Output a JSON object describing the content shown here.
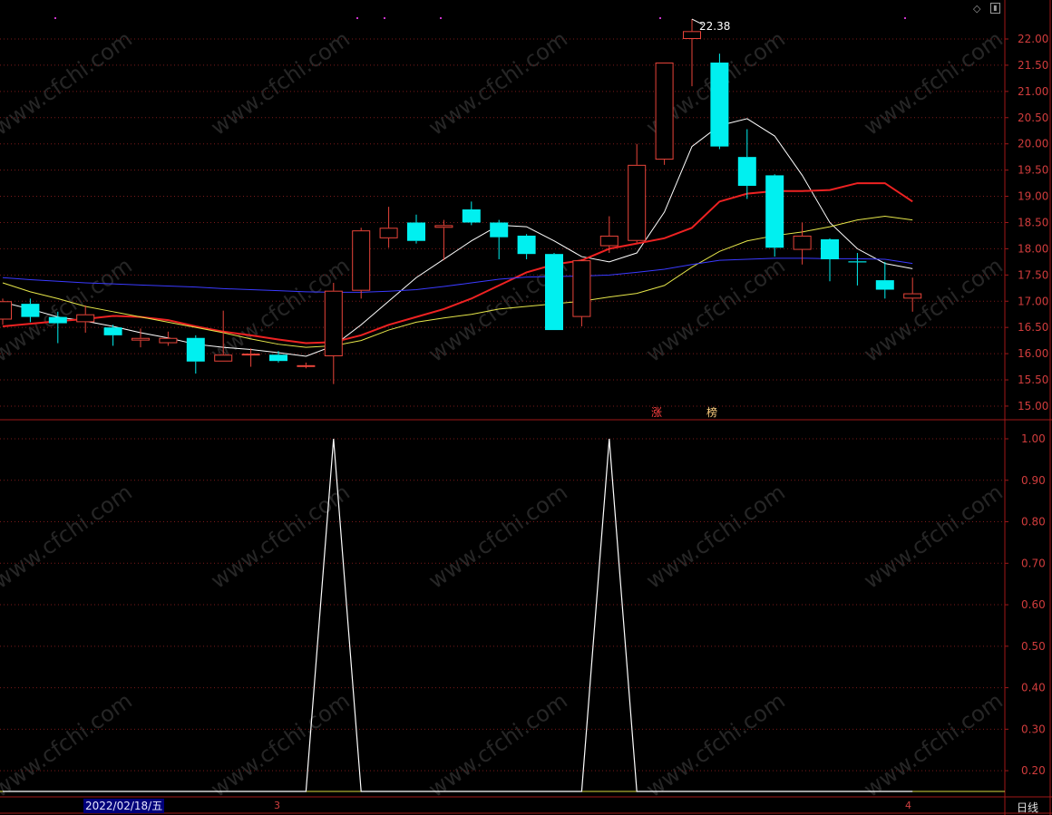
{
  "chart_data": [
    {
      "type": "candlestick",
      "title": "",
      "ylim": [
        14.8,
        22.45
      ],
      "y_ticks": [
        "22.00",
        "21.50",
        "21.00",
        "20.50",
        "20.00",
        "19.50",
        "19.00",
        "18.50",
        "18.00",
        "17.50",
        "17.00",
        "16.50",
        "16.00",
        "15.50",
        "15.00"
      ],
      "candles": [
        {
          "open": 16.65,
          "close": 17.0,
          "high": 17.05,
          "low": 16.55
        },
        {
          "open": 16.95,
          "close": 16.7,
          "high": 17.05,
          "low": 16.6
        },
        {
          "open": 16.7,
          "close": 16.58,
          "high": 16.8,
          "low": 16.2
        },
        {
          "open": 16.6,
          "close": 16.75,
          "high": 16.92,
          "low": 16.4
        },
        {
          "open": 16.5,
          "close": 16.35,
          "high": 16.55,
          "low": 16.15
        },
        {
          "open": 16.25,
          "close": 16.3,
          "high": 16.48,
          "low": 16.12
        },
        {
          "open": 16.2,
          "close": 16.3,
          "high": 16.42,
          "low": 16.15
        },
        {
          "open": 16.3,
          "close": 15.85,
          "high": 16.35,
          "low": 15.62
        },
        {
          "open": 15.85,
          "close": 15.98,
          "high": 16.82,
          "low": 15.85
        },
        {
          "open": 15.98,
          "close": 16.0,
          "high": 16.1,
          "low": 15.75
        },
        {
          "open": 15.98,
          "close": 15.86,
          "high": 16.05,
          "low": 15.83
        },
        {
          "open": 15.76,
          "close": 15.78,
          "high": 15.83,
          "low": 15.72
        },
        {
          "open": 15.95,
          "close": 17.2,
          "high": 17.35,
          "low": 15.42
        },
        {
          "open": 17.2,
          "close": 18.35,
          "high": 18.4,
          "low": 17.05
        },
        {
          "open": 18.2,
          "close": 18.4,
          "high": 18.8,
          "low": 18.02
        },
        {
          "open": 18.5,
          "close": 18.15,
          "high": 18.65,
          "low": 18.1
        },
        {
          "open": 18.4,
          "close": 18.45,
          "high": 18.55,
          "low": 17.78
        },
        {
          "open": 18.75,
          "close": 18.5,
          "high": 18.9,
          "low": 18.45
        },
        {
          "open": 18.5,
          "close": 18.22,
          "high": 18.55,
          "low": 17.8
        },
        {
          "open": 18.25,
          "close": 17.9,
          "high": 18.28,
          "low": 17.8
        },
        {
          "open": 17.9,
          "close": 16.45,
          "high": 17.92,
          "low": 16.45
        },
        {
          "open": 16.7,
          "close": 17.78,
          "high": 17.8,
          "low": 16.52
        },
        {
          "open": 18.05,
          "close": 18.25,
          "high": 18.62,
          "low": 17.92
        },
        {
          "open": 18.15,
          "close": 19.6,
          "high": 20.0,
          "low": 18.12
        },
        {
          "open": 19.7,
          "close": 21.55,
          "high": 21.55,
          "low": 19.6
        },
        {
          "open": 22.0,
          "close": 22.15,
          "high": 22.38,
          "low": 21.1
        },
        {
          "open": 21.55,
          "close": 19.95,
          "high": 21.72,
          "low": 19.9
        },
        {
          "open": 19.75,
          "close": 19.2,
          "high": 20.28,
          "low": 18.95
        },
        {
          "open": 19.4,
          "close": 18.02,
          "high": 19.42,
          "low": 17.85
        },
        {
          "open": 17.98,
          "close": 18.25,
          "high": 18.5,
          "low": 17.7
        },
        {
          "open": 18.18,
          "close": 17.8,
          "high": 18.2,
          "low": 17.38
        },
        {
          "open": 17.76,
          "close": 17.74,
          "high": 17.92,
          "low": 17.3
        },
        {
          "open": 17.4,
          "close": 17.22,
          "high": 17.75,
          "low": 17.05
        },
        {
          "open": 17.05,
          "close": 17.15,
          "high": 17.45,
          "low": 16.8
        }
      ],
      "series": [
        {
          "color": "#ffffff",
          "values": [
            16.98,
            16.85,
            16.7,
            16.62,
            16.52,
            16.4,
            16.3,
            16.18,
            16.12,
            16.08,
            16.02,
            15.95,
            16.15,
            16.55,
            17.0,
            17.45,
            17.8,
            18.15,
            18.45,
            18.42,
            18.15,
            17.85,
            17.75,
            17.92,
            18.7,
            19.95,
            20.35,
            20.48,
            20.15,
            19.4,
            18.5,
            18.0,
            17.72,
            17.62
          ]
        },
        {
          "color": "#ee2222",
          "values": [
            16.52,
            16.57,
            16.62,
            16.66,
            16.72,
            16.7,
            16.64,
            16.52,
            16.42,
            16.35,
            16.27,
            16.2,
            16.22,
            16.35,
            16.55,
            16.7,
            16.85,
            17.05,
            17.3,
            17.55,
            17.7,
            17.78,
            18.0,
            18.1,
            18.2,
            18.4,
            18.9,
            19.05,
            19.1,
            19.1,
            19.12,
            19.25,
            19.25,
            18.9
          ]
        },
        {
          "color": "#e6e64a",
          "values": [
            17.35,
            17.18,
            17.05,
            16.9,
            16.8,
            16.7,
            16.6,
            16.5,
            16.4,
            16.28,
            16.18,
            16.12,
            16.15,
            16.25,
            16.45,
            16.6,
            16.68,
            16.75,
            16.85,
            16.9,
            16.95,
            17.0,
            17.08,
            17.15,
            17.3,
            17.65,
            17.95,
            18.15,
            18.25,
            18.32,
            18.42,
            18.55,
            18.62,
            18.55
          ]
        },
        {
          "color": "#3a3aff",
          "values": [
            17.45,
            17.41,
            17.38,
            17.35,
            17.33,
            17.31,
            17.29,
            17.27,
            17.24,
            17.22,
            17.2,
            17.18,
            17.17,
            17.17,
            17.19,
            17.22,
            17.28,
            17.35,
            17.42,
            17.46,
            17.47,
            17.48,
            17.5,
            17.55,
            17.61,
            17.7,
            17.78,
            17.8,
            17.82,
            17.82,
            17.81,
            17.81,
            17.8,
            17.72
          ]
        }
      ],
      "annotations": {
        "high_label": "22.38",
        "zhang": "涨",
        "bang": "榜"
      }
    },
    {
      "type": "line",
      "ylim": [
        0,
        1.05
      ],
      "y_ticks": [
        "1.00",
        "0.90",
        "0.80",
        "0.70",
        "0.60",
        "0.50",
        "0.40",
        "0.30",
        "0.20"
      ],
      "series": [
        {
          "color": "#ffffff",
          "values": [
            0,
            0,
            0,
            0,
            0,
            0,
            0,
            0,
            0,
            0,
            0,
            0,
            1,
            0,
            0,
            0,
            0,
            0,
            0,
            0,
            0,
            0,
            1,
            0,
            0,
            0,
            0,
            0,
            0,
            0,
            0,
            0,
            0,
            0
          ]
        }
      ]
    }
  ],
  "x_axis": {
    "date_label": "2022/02/18/五",
    "month_labels": [
      "3",
      "4"
    ]
  },
  "period": {
    "label": "日线"
  },
  "watermark": "www.cfchi.com",
  "colors": {
    "up": "#e8443a",
    "down": "#00f0f0",
    "grid": "#7a1a1a",
    "axis": "#a01818",
    "tick": "#d03c3c"
  }
}
